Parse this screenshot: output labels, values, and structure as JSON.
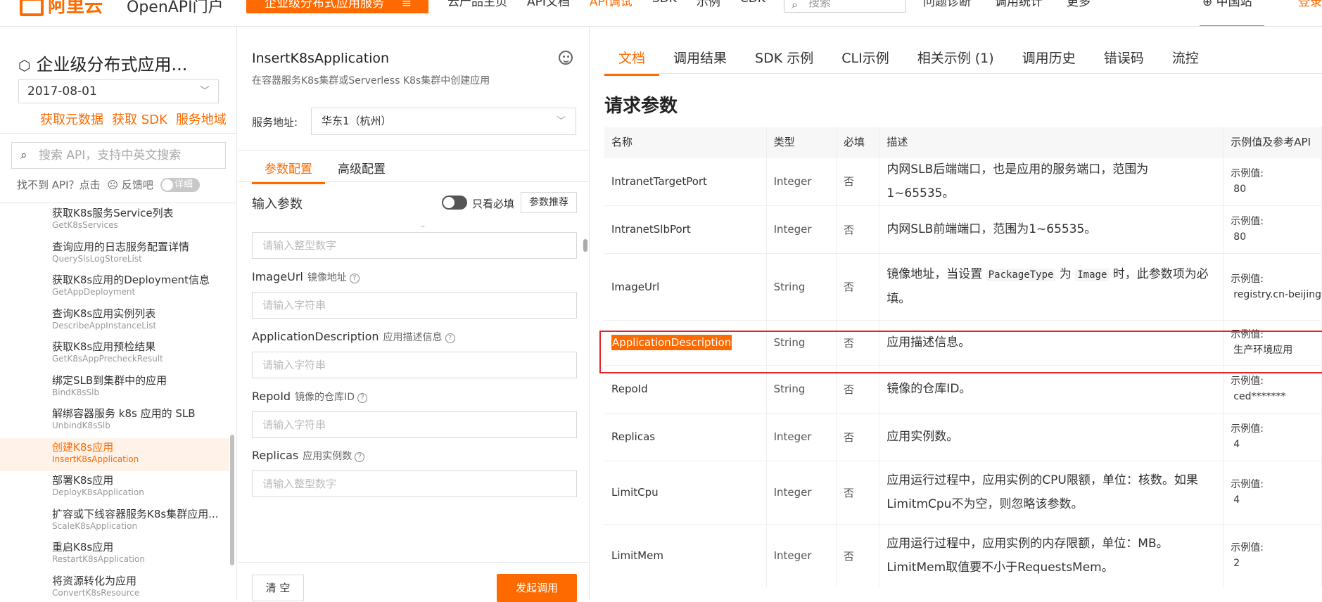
{
  "header": {
    "logo_text": "阿里云",
    "portal_name": "OpenAPI门户",
    "product_button": "企业级分布式应用服务",
    "nav": [
      "云产品主页",
      "API文档",
      "API调试",
      "SDK",
      "示例",
      "CDK"
    ],
    "active_nav_index": 2,
    "search_placeholder": "搜索",
    "right_links": [
      "问题诊断",
      "调用统计",
      "更多"
    ],
    "region": "中国站",
    "login": "登录"
  },
  "sidebar": {
    "product_title": "企业级分布式应用...",
    "version": "2017-08-01",
    "links": [
      "获取元数据",
      "获取 SDK",
      "服务地域"
    ],
    "search_placeholder": "搜索 API，支持中英文搜索",
    "feedback_text": "找不到 API？点击",
    "feedback_link": "反馈吧",
    "detail_toggle": "详细",
    "items": [
      {
        "cn": "获取K8s服务Service列表",
        "en": "GetK8sServices"
      },
      {
        "cn": "查询应用的日志服务配置详情",
        "en": "QuerySlsLogStoreList"
      },
      {
        "cn": "获取K8s应用的Deployment信息",
        "en": "GetAppDeployment"
      },
      {
        "cn": "查询K8s应用实例列表",
        "en": "DescribeAppInstanceList"
      },
      {
        "cn": "获取K8s应用预检结果",
        "en": "GetK8sAppPrecheckResult"
      },
      {
        "cn": "绑定SLB到集群中的应用",
        "en": "BindK8sSlb"
      },
      {
        "cn": "解绑容器服务 k8s 应用的 SLB",
        "en": "UnbindK8sSlb"
      },
      {
        "cn": "创建K8s应用",
        "en": "InsertK8sApplication"
      },
      {
        "cn": "部署K8s应用",
        "en": "DeployK8sApplication"
      },
      {
        "cn": "扩容或下线容器服务K8s集群应用...",
        "en": "ScaleK8sApplication"
      },
      {
        "cn": "重启K8s应用",
        "en": "RestartK8sApplication"
      },
      {
        "cn": "将资源转化为应用",
        "en": "ConvertK8sResource"
      }
    ],
    "active_index": 7
  },
  "debug": {
    "api_name": "InsertK8sApplication",
    "api_desc": "在容器服务K8s集群或Serverless K8s集群中创建应用",
    "endpoint_label": "服务地址:",
    "endpoint_value": "华东1（杭州）",
    "tabs": [
      "参数配置",
      "高级配置"
    ],
    "input_params_label": "输入参数",
    "required_only_label": "只看必填",
    "recommend_button": "参数推荐",
    "params": [
      {
        "name": "",
        "desc": "",
        "placeholder": "请输入整型数字"
      },
      {
        "name": "ImageUrl",
        "desc": "镜像地址",
        "placeholder": "请输入字符串"
      },
      {
        "name": "ApplicationDescription",
        "desc": "应用描述信息",
        "placeholder": "请输入字符串"
      },
      {
        "name": "RepoId",
        "desc": "镜像的仓库ID",
        "placeholder": "请输入字符串"
      },
      {
        "name": "Replicas",
        "desc": "应用实例数",
        "placeholder": "请输入整型数字"
      }
    ],
    "clear_button": "清 空",
    "invoke_button": "发起调用"
  },
  "doc": {
    "tabs": [
      "文档",
      "调用结果",
      "SDK 示例",
      "CLI示例",
      "相关示例 (1)",
      "调用历史",
      "错误码",
      "流控"
    ],
    "heading": "请求参数",
    "columns": [
      "名称",
      "类型",
      "必填",
      "描述",
      "示例值及参考API"
    ],
    "example_label": "示例值:",
    "rows": [
      {
        "name": "IntranetTargetPort",
        "type": "Integer",
        "required": "否",
        "desc": "内网SLB后端端口，也是应用的服务端口，范围为1~65535。",
        "example": "80"
      },
      {
        "name": "IntranetSlbPort",
        "type": "Integer",
        "required": "否",
        "desc": "内网SLB前端端口，范围为1~65535。",
        "example": "80"
      },
      {
        "name": "ImageUrl",
        "type": "String",
        "required": "否",
        "desc_pre": "镜像地址，当设置 ",
        "desc_code1": "PackageType",
        "desc_mid": " 为 ",
        "desc_code2": "Image",
        "desc_post": " 时，此参数项为必填。",
        "example": "registry.cn-beijing"
      },
      {
        "name": "ApplicationDescription",
        "type": "String",
        "required": "否",
        "desc": "应用描述信息。",
        "example": "生产环境应用"
      },
      {
        "name": "RepoId",
        "type": "String",
        "required": "否",
        "desc": "镜像的仓库ID。",
        "example": "ced*******"
      },
      {
        "name": "Replicas",
        "type": "Integer",
        "required": "否",
        "desc": "应用实例数。",
        "example": "4"
      },
      {
        "name": "LimitCpu",
        "type": "Integer",
        "required": "否",
        "desc": "应用运行过程中，应用实例的CPU限额，单位：核数。如果LimitmCpu不为空，则忽略该参数。",
        "example": "4"
      },
      {
        "name": "LimitMem",
        "type": "Integer",
        "required": "否",
        "desc": "应用运行过程中，应用实例的内存限额，单位：MB。LimitMem取值要不小于RequestsMem。",
        "example": "2"
      }
    ]
  },
  "colors": {
    "accent": "#ff6a00",
    "highlight_border": "#e4242b"
  }
}
